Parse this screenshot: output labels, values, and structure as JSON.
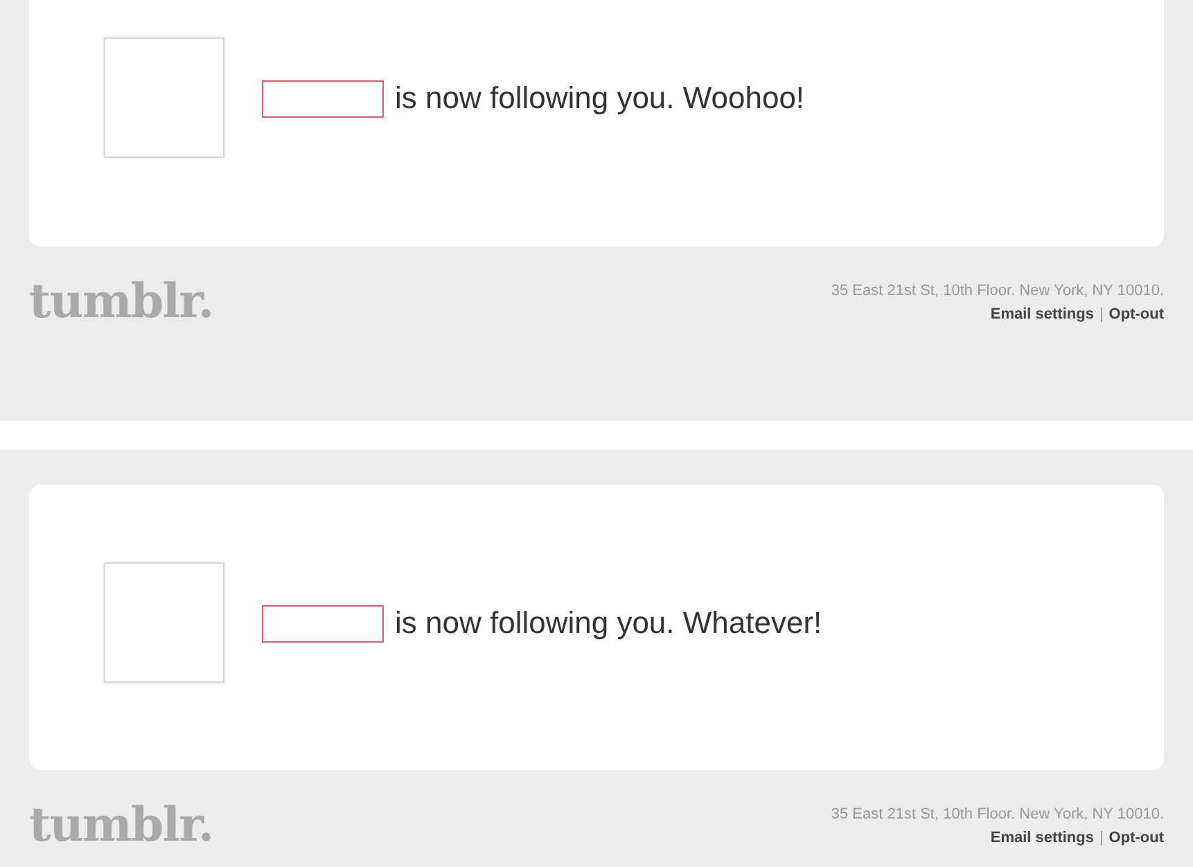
{
  "emails": [
    {
      "message": "is now following you. Woohoo!",
      "logo": "tumblr.",
      "address": "35 East 21st St, 10th Floor. New York, NY 10010.",
      "links": [
        "Email settings",
        "Opt-out"
      ],
      "separator": "|"
    },
    {
      "message": "is now following you. Whatever!",
      "logo": "tumblr.",
      "address": "35 East 21st St, 10th Floor. New York, NY 10010.",
      "links": [
        "Email settings",
        "Opt-out"
      ],
      "separator": "|"
    }
  ]
}
